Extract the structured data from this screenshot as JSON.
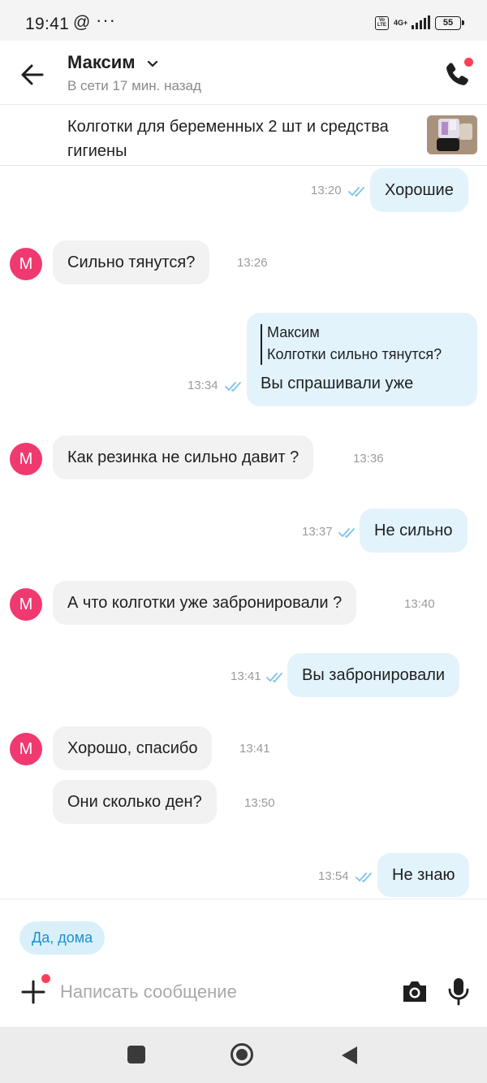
{
  "status_bar": {
    "time": "19:41",
    "at_symbol": "@",
    "more": "···",
    "volte": "Vo LTE",
    "network": "4G+",
    "battery": "55"
  },
  "header": {
    "contact_name": "Максим",
    "contact_status": "В сети 17 мин. назад"
  },
  "item": {
    "title": "Колготки для беременных 2 шт и средства гигиены"
  },
  "messages": [
    {
      "dir": "out",
      "text": "Хорошие",
      "time": "13:20"
    },
    {
      "dir": "in",
      "avatar": "М",
      "text": "Сильно тянутся?",
      "time": "13:26"
    },
    {
      "dir": "out",
      "quote_author": "Максим",
      "quote_text": "Колготки сильно тянутся?",
      "text": "Вы спрашивали уже",
      "time": "13:34"
    },
    {
      "dir": "in",
      "avatar": "М",
      "text": "Как резинка не сильно давит ?",
      "time": "13:36"
    },
    {
      "dir": "out",
      "text": "Не сильно",
      "time": "13:37"
    },
    {
      "dir": "in",
      "avatar": "М",
      "text": "А что колготки уже забронировали ?",
      "time": "13:40"
    },
    {
      "dir": "out",
      "text": "Вы забронировали",
      "time": "13:41"
    },
    {
      "dir": "in",
      "avatar": "М",
      "text": "Хорошо, спасибо",
      "time": "13:41"
    },
    {
      "dir": "in",
      "text": "Они сколько ден?",
      "time": "13:50"
    },
    {
      "dir": "out",
      "text": "Не знаю",
      "time": "13:54"
    }
  ],
  "composer": {
    "quick_reply": "Да, дома",
    "placeholder": "Написать сообщение"
  },
  "colors": {
    "accent_blue": "#1b8fd1",
    "outgoing_bubble": "#e2f3fc",
    "incoming_bubble": "#f2f2f2",
    "avatar": "#f0396f",
    "notification_dot": "#ff3f55"
  },
  "icons": [
    "back-arrow-icon",
    "chevron-down-icon",
    "phone-icon",
    "double-check-icon",
    "plus-icon",
    "camera-icon",
    "microphone-icon",
    "nav-recents-icon",
    "nav-home-icon",
    "nav-back-icon"
  ]
}
